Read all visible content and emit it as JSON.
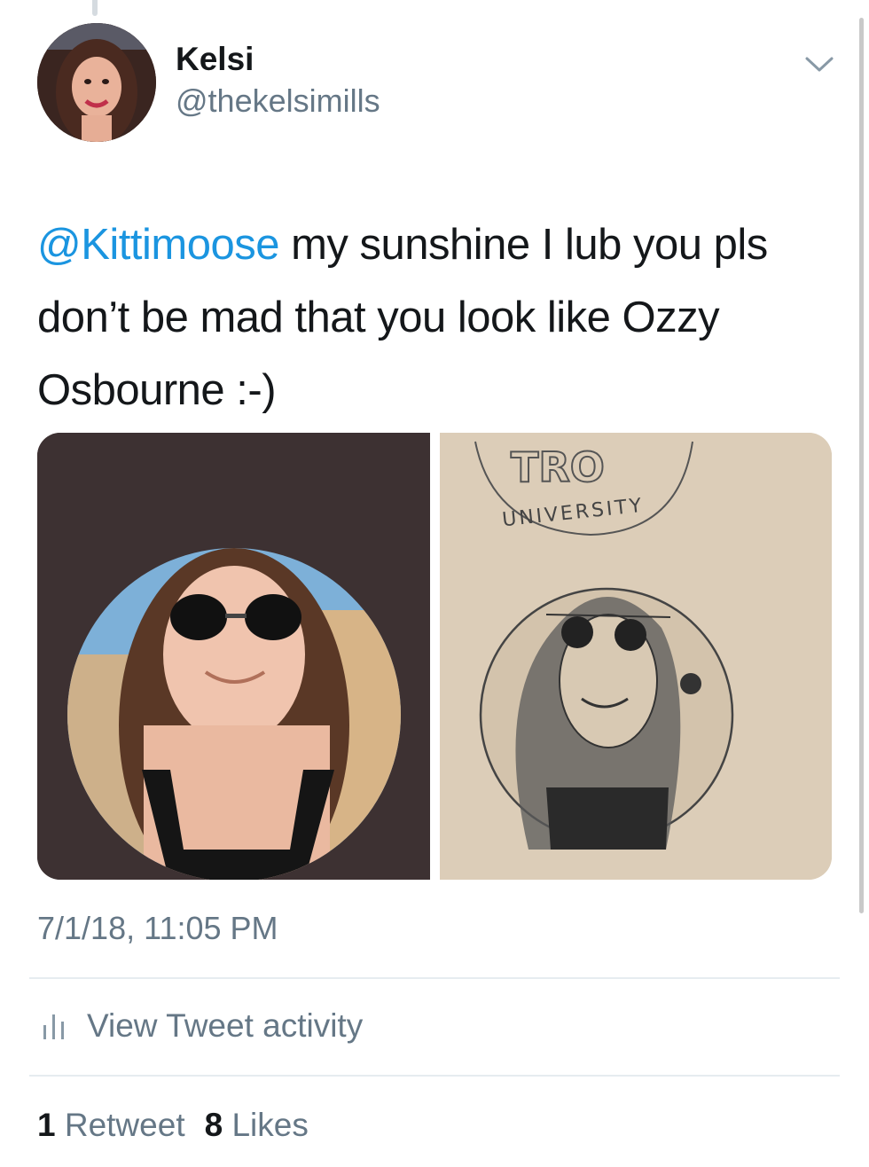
{
  "author": {
    "name": "Kelsi",
    "handle": "@thekelsimills"
  },
  "tweet": {
    "mention": "@Kittimoose",
    "text": " my sunshine I lub you pls don’t be mad that you look like Ozzy Osbourne :-)",
    "timestamp": "7/1/18, 11:05 PM"
  },
  "media": {
    "right_drawing_text": "UNIVERSITY"
  },
  "activity": {
    "label": "View Tweet activity",
    "icon": "bar-chart-icon"
  },
  "stats": {
    "retweets_count": "1",
    "retweets_label": "Retweet",
    "likes_count": "8",
    "likes_label": "Likes"
  },
  "colors": {
    "link": "#1b95e0",
    "secondary_text": "#657786",
    "primary_text": "#14171a"
  }
}
